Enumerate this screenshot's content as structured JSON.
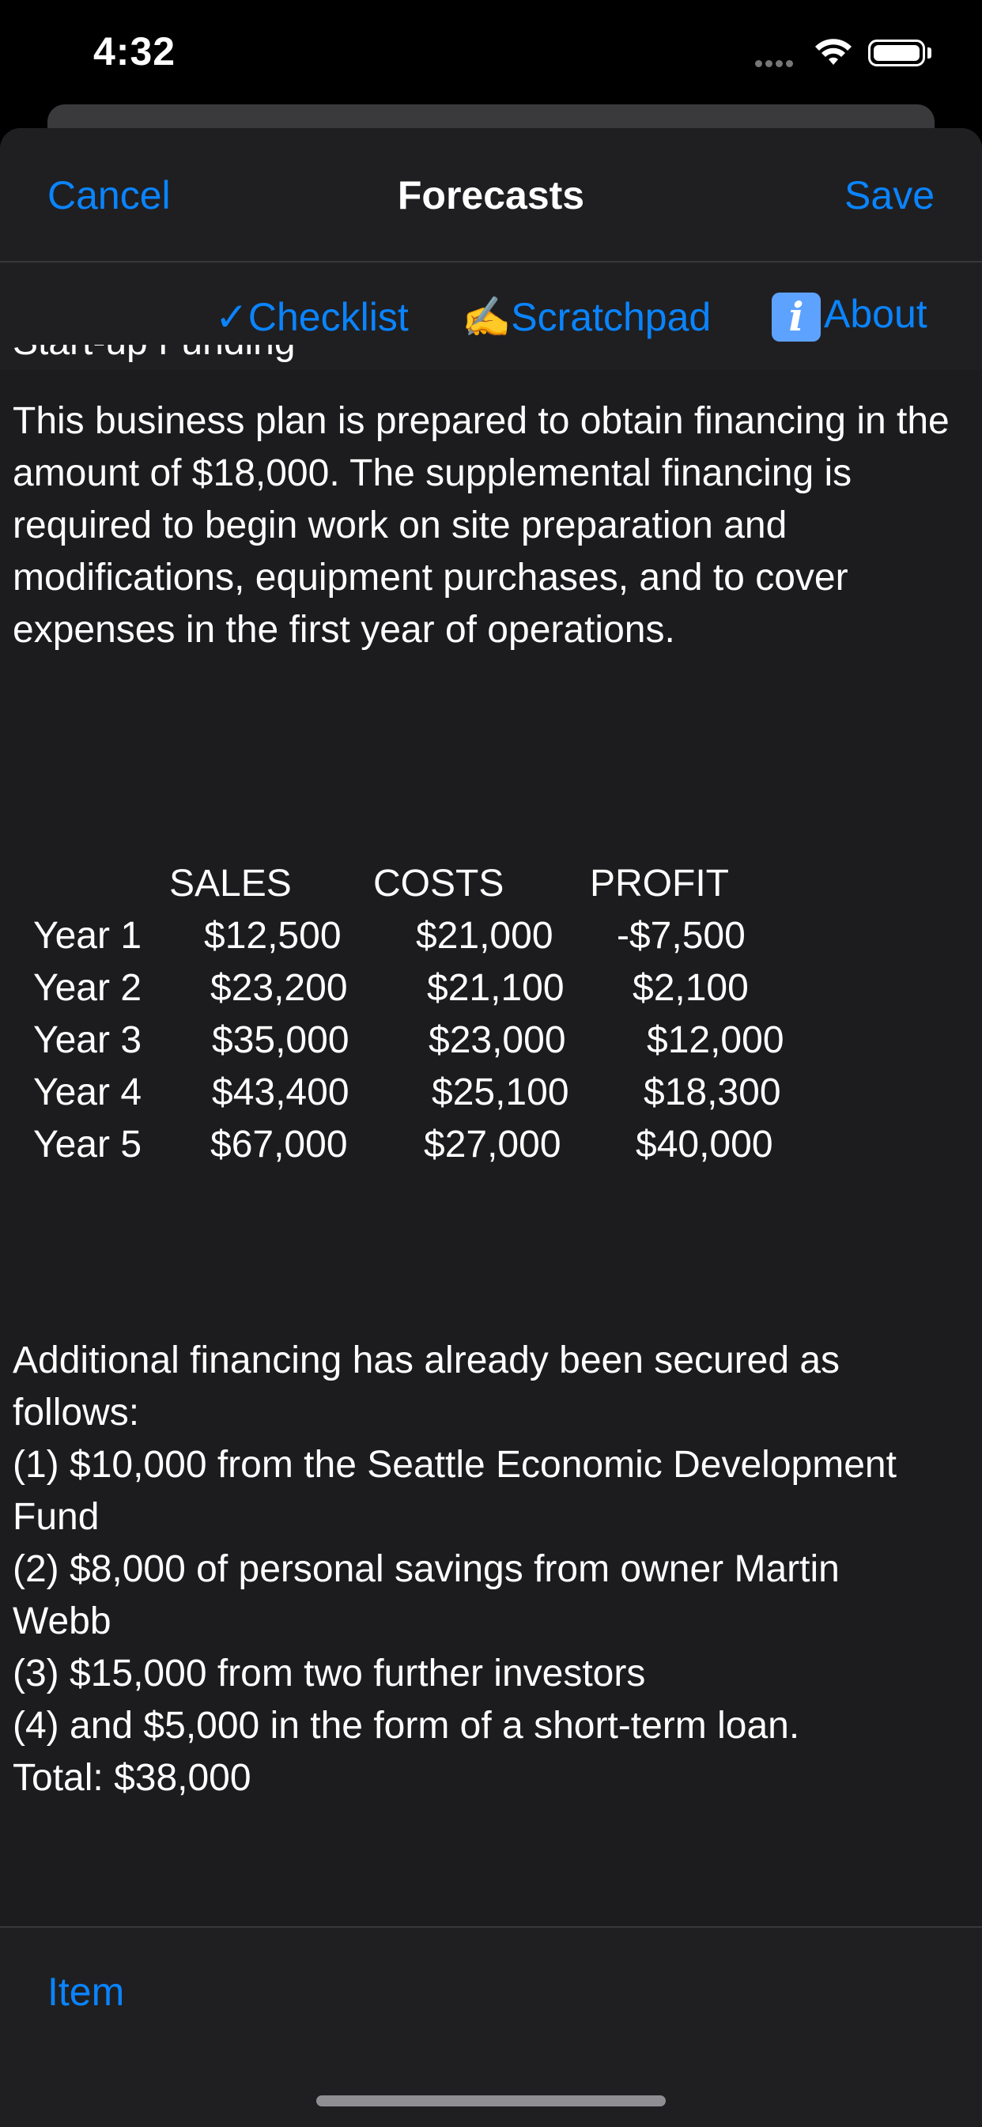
{
  "status": {
    "time": "4:32"
  },
  "nav": {
    "cancel": "Cancel",
    "title": "Forecasts",
    "save": "Save"
  },
  "toolbar": {
    "checklist": "✓Checklist",
    "scratchpad": "✍️Scratchpad",
    "about_icon": "i",
    "about": "About"
  },
  "content": {
    "heading_clipped": "Start-up Funding",
    "intro": "This business plan is prepared to obtain financing in the amount of $18,000. The supplemental financing is required to begin work on site preparation and modifications, equipment purchases, and to cover expenses in the first year of operations."
  },
  "table": {
    "headers": [
      "SALES",
      "COSTS",
      "PROFIT"
    ],
    "rows": [
      {
        "label": "Year 1",
        "sales": "$12,500",
        "costs": "$21,000",
        "profit": "-$7,500"
      },
      {
        "label": "Year 2",
        "sales": "$23,200",
        "costs": "$21,100",
        "profit": "$2,100"
      },
      {
        "label": "Year 3",
        "sales": "$35,000",
        "costs": "$23,000",
        "profit": "$12,000"
      },
      {
        "label": "Year 4",
        "sales": "$43,400",
        "costs": "$25,100",
        "profit": "$18,300"
      },
      {
        "label": "Year 5",
        "sales": "$67,000",
        "costs": "$27,000",
        "profit": "$40,000"
      }
    ]
  },
  "additional": {
    "lines": [
      "Additional financing has already been secured as",
      "follows:",
      "(1) $10,000 from the Seattle Economic Development",
      "Fund",
      "(2) $8,000 of personal savings from owner Martin",
      "Webb",
      "(3) $15,000 from two further investors",
      "(4) and $5,000 in the form of a short-term loan.",
      "Total: $38,000"
    ]
  },
  "bottom": {
    "item": "Item"
  }
}
